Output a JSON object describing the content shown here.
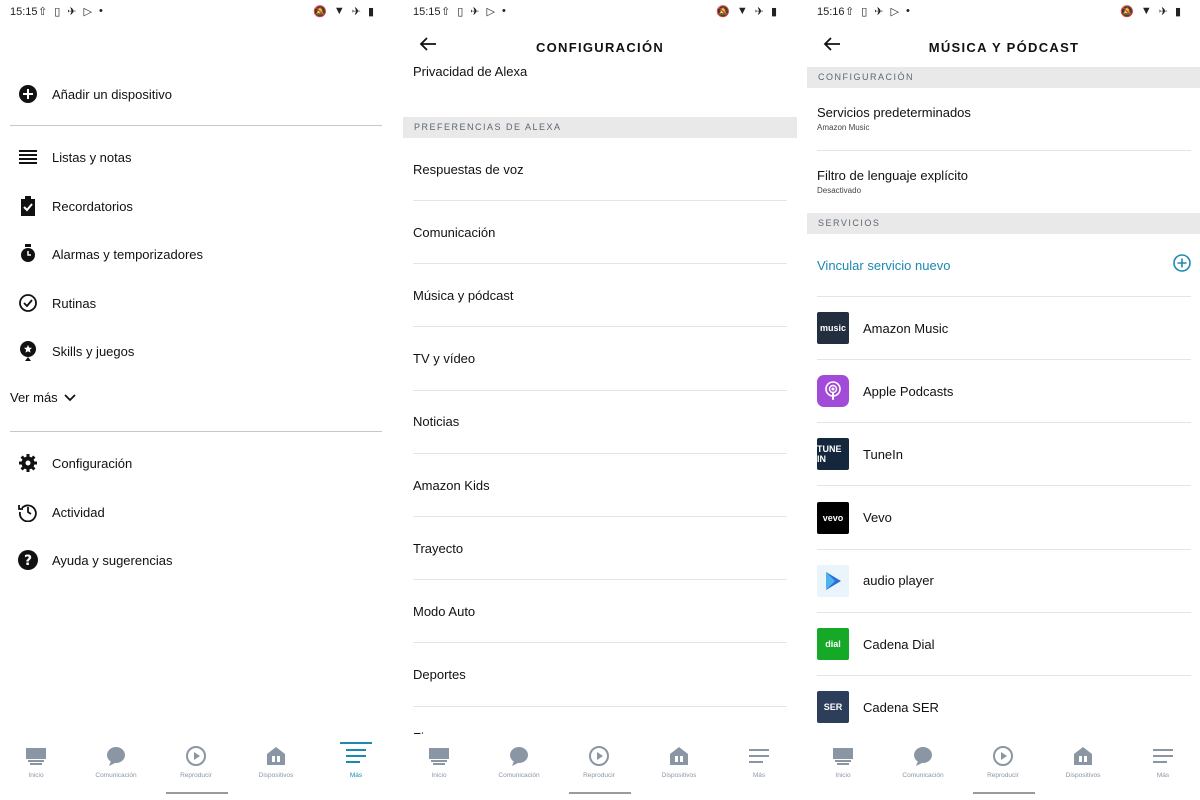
{
  "screen1": {
    "status_time": "15:15",
    "menu": {
      "add_device": "Añadir un dispositivo",
      "lists": "Listas y notas",
      "reminders": "Recordatorios",
      "alarms": "Alarmas y temporizadores",
      "routines": "Rutinas",
      "skills": "Skills y juegos",
      "see_more": "Ver más",
      "settings": "Configuración",
      "activity": "Actividad",
      "help": "Ayuda y sugerencias"
    }
  },
  "screen2": {
    "status_time": "15:15",
    "title": "CONFIGURACIÓN",
    "partial_top": "Privacidad de Alexa",
    "section": "PREFERENCIAS DE ALEXA",
    "items": [
      "Respuestas de voz",
      "Comunicación",
      "Música y pódcast",
      "TV y vídeo",
      "Noticias",
      "Amazon Kids",
      "Trayecto",
      "Modo Auto",
      "Deportes",
      "Finanzas"
    ]
  },
  "screen3": {
    "status_time": "15:16",
    "title": "MÚSICA Y PÓDCAST",
    "section_config": "CONFIGURACIÓN",
    "default_services": {
      "title": "Servicios predeterminados",
      "sub": "Amazon Music"
    },
    "explicit_filter": {
      "title": "Filtro de lenguaje explícito",
      "sub": "Desactivado"
    },
    "section_services": "SERVICIOS",
    "link_new": "Vincular servicio nuevo",
    "services": [
      {
        "name": "Amazon Music",
        "logo_text": "music",
        "color": "#232f3e"
      },
      {
        "name": "Apple Podcasts",
        "logo_text": "",
        "color": "#a24bd8"
      },
      {
        "name": "TuneIn",
        "logo_text": "TUNE IN",
        "color": "#14273d"
      },
      {
        "name": "Vevo",
        "logo_text": "vevo",
        "color": "#000000"
      },
      {
        "name": "audio player",
        "logo_text": "",
        "color": "#e9f4fb"
      },
      {
        "name": "Cadena Dial",
        "logo_text": "dial",
        "color": "#16a928"
      },
      {
        "name": "Cadena SER",
        "logo_text": "SER",
        "color": "#2c3e5a"
      }
    ]
  },
  "nav": {
    "tabs": [
      "Inicio",
      "Comunicación",
      "Reproducir",
      "Dispositivos",
      "Más"
    ]
  },
  "colors": {
    "accent": "#1a8ab0",
    "section_bg": "#e9e9e9"
  }
}
